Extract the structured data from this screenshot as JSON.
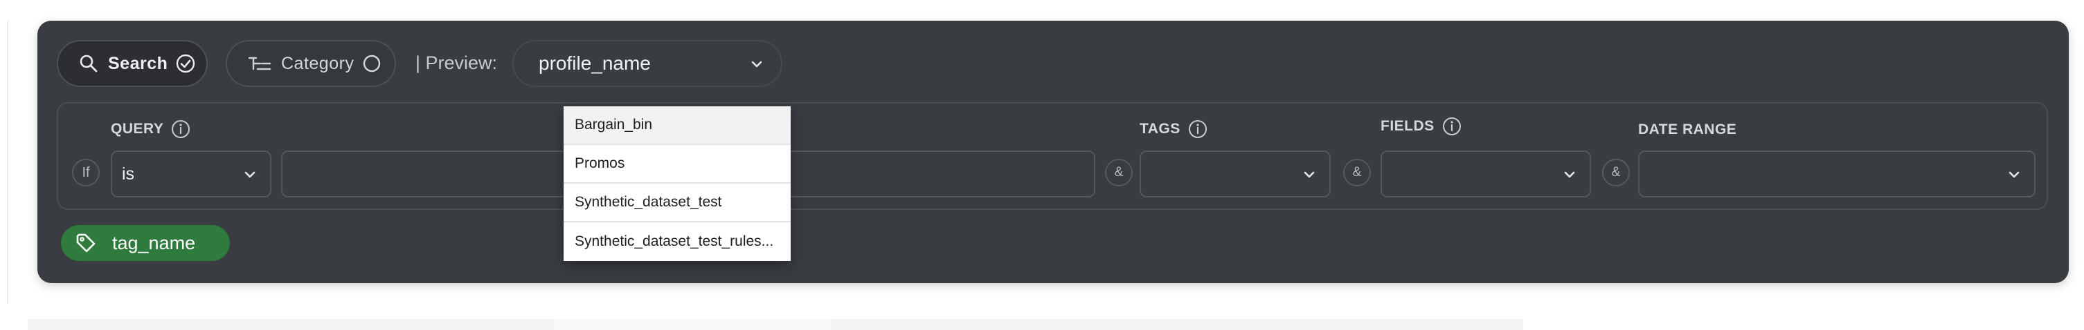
{
  "toolbar": {
    "search_label": "Search",
    "category_label": "Category",
    "preview_label": "| Preview:",
    "preview_value": "profile_name"
  },
  "query_section": {
    "query_label": "QUERY",
    "tags_label": "TAGS",
    "fields_label": "FIELDS",
    "date_range_label": "DATE RANGE",
    "if_label": "If",
    "operator_value": "is",
    "connector": "&",
    "query_text": "",
    "tags_value": "",
    "fields_value": "",
    "date_range_value": ""
  },
  "tag": {
    "name": "tag_name",
    "color": "#2f7a3d"
  },
  "dropdown": {
    "options": [
      "Bargain_bin",
      "Promos",
      "Synthetic_dataset_test",
      "Synthetic_dataset_test_rules..."
    ],
    "highlighted_index": 0
  },
  "colors": {
    "panel_bg": "#393c41",
    "tag_green": "#2f7a3d"
  }
}
